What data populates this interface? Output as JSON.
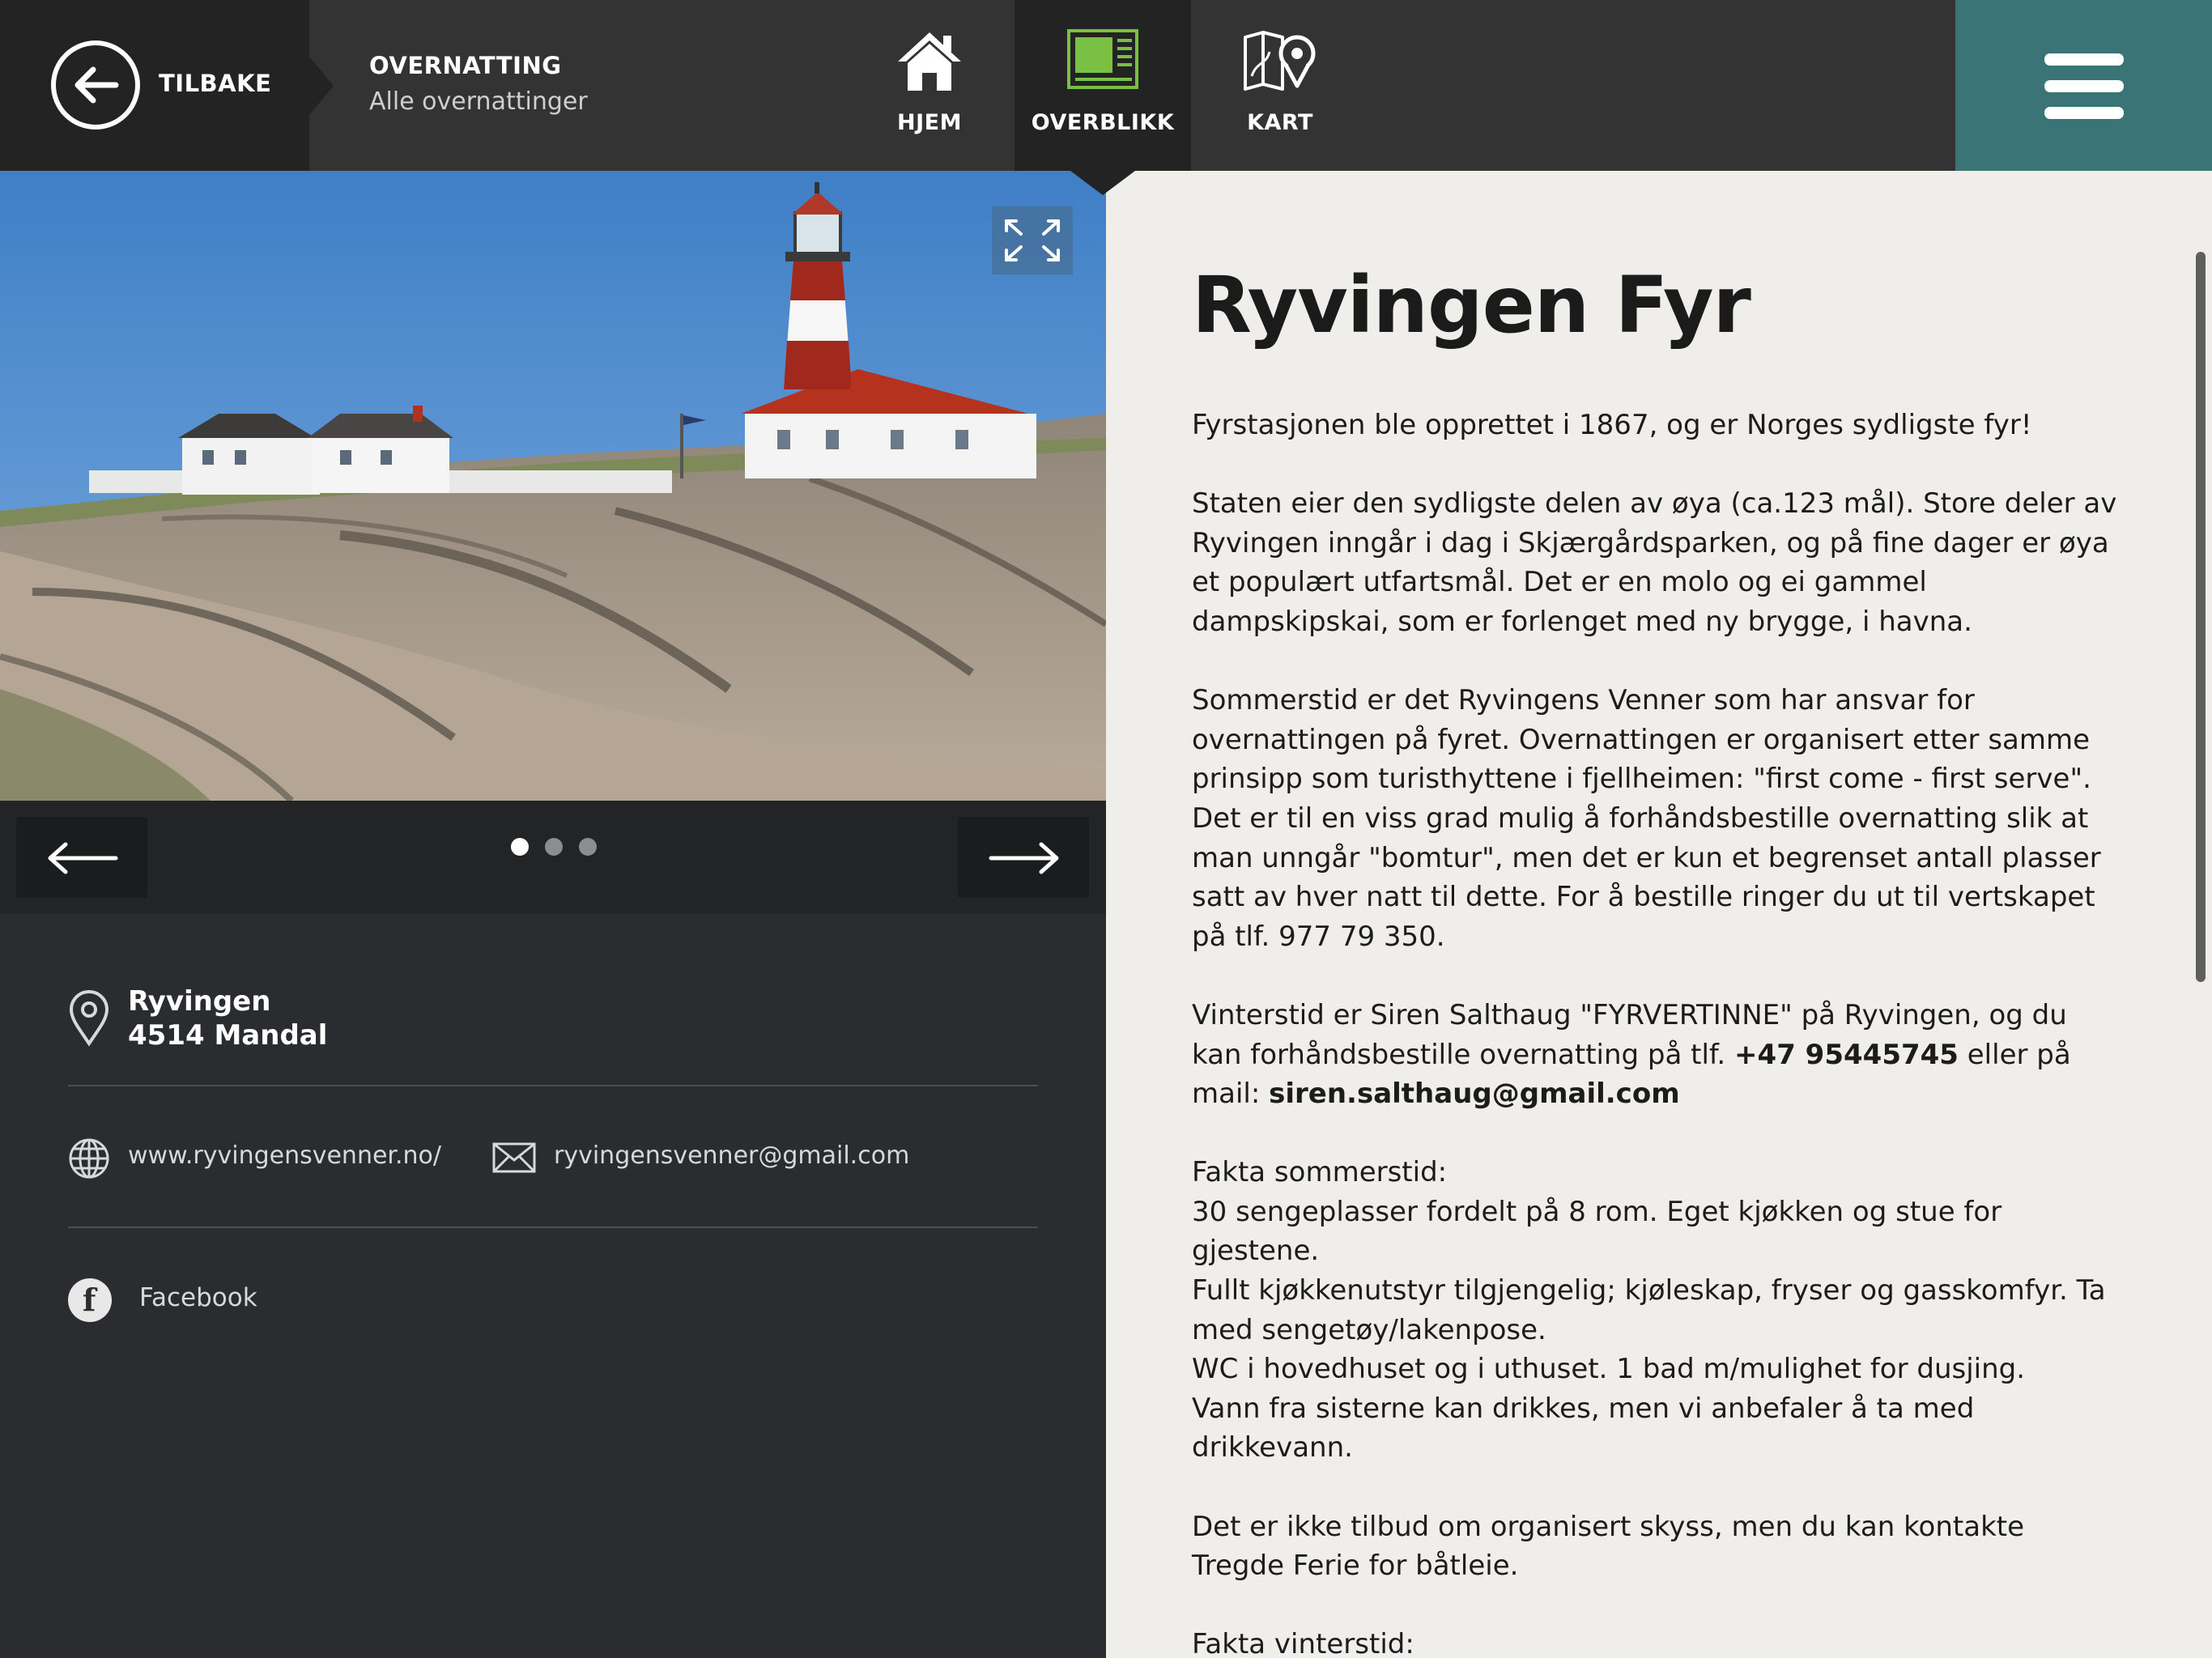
{
  "header": {
    "back_label": "TILBAKE",
    "breadcrumb_title": "OVERNATTING",
    "breadcrumb_subtitle": "Alle overnattinger",
    "nav": [
      {
        "label": "HJEM",
        "icon": "home-icon"
      },
      {
        "label": "OVERBLIKK",
        "icon": "overview-icon",
        "active": true
      },
      {
        "label": "KART",
        "icon": "map-pin-icon"
      }
    ],
    "menu_icon": "hamburger-menu-icon"
  },
  "gallery": {
    "image_count": 3,
    "active_index": 0,
    "expand_icon": "expand-icon",
    "prev_icon": "arrow-left-icon",
    "next_icon": "arrow-right-icon"
  },
  "info": {
    "address_line1": "Ryvingen",
    "address_line2": "4514 Mandal",
    "website": "www.ryvingensvenner.no/",
    "email": "ryvingensvenner@gmail.com",
    "facebook": "Facebook"
  },
  "article": {
    "title": "Ryvingen Fyr",
    "p1": "Fyrstasjonen ble opprettet i 1867, og er Norges sydligste fyr!",
    "p2": "Staten eier den sydligste delen av øya (ca.123 mål). Store deler av Ryvingen inngår i dag i Skjærgårdsparken, og på fine dager er øya et populært utfartsmål. Det er en molo og ei gammel dampskipskai, som er forlenget med ny brygge, i havna.",
    "p3": "Sommerstid er det Ryvingens Venner som har ansvar for overnattingen på fyret. Overnattingen er organisert etter samme prinsipp som turisthyttene i fjellheimen: \"first come - first serve\". Det er til en viss grad mulig å forhåndsbestille overnatting slik at man unngår \"bomtur\", men det er kun et begrenset antall plasser satt av hver natt til dette. For å bestille ringer du ut til vertskapet på tlf. 977 79 350.",
    "p4_start": "Vinterstid er Siren Salthaug \"FYRVERTINNE\" på Ryvingen, og du kan forhåndsbestille overnatting på tlf. ",
    "p4_phone": "+47 95445745",
    "p4_mid": " eller på mail: ",
    "p4_email": "siren.salthaug@gmail.com",
    "facts_summer_heading": "Fakta sommerstid:",
    "facts_summer_1": "30 sengeplasser fordelt på 8 rom. Eget kjøkken og stue for gjestene.",
    "facts_summer_2": "Fullt kjøkkenutstyr tilgjengelig; kjøleskap, fryser og gasskomfyr. Ta med sengetøy/lakenpose.",
    "facts_summer_3": "WC i hovedhuset og i uthuset. 1 bad m/mulighet for dusjing.",
    "facts_summer_4": "Vann fra sisterne kan drikkes, men vi anbefaler å ta med drikkevann.",
    "p6": "Det er ikke tilbud om organisert skyss, men du kan kontakte Tregde Ferie for båtleie.",
    "facts_winter_heading": "Fakta vinterstid:"
  },
  "colors": {
    "topbar": "#333333",
    "back_area": "#232323",
    "menu_button": "#3b7476",
    "overview_icon_green": "#7ac143",
    "content_bg": "#efeeeb",
    "panel_bg": "#2a2c2f"
  }
}
